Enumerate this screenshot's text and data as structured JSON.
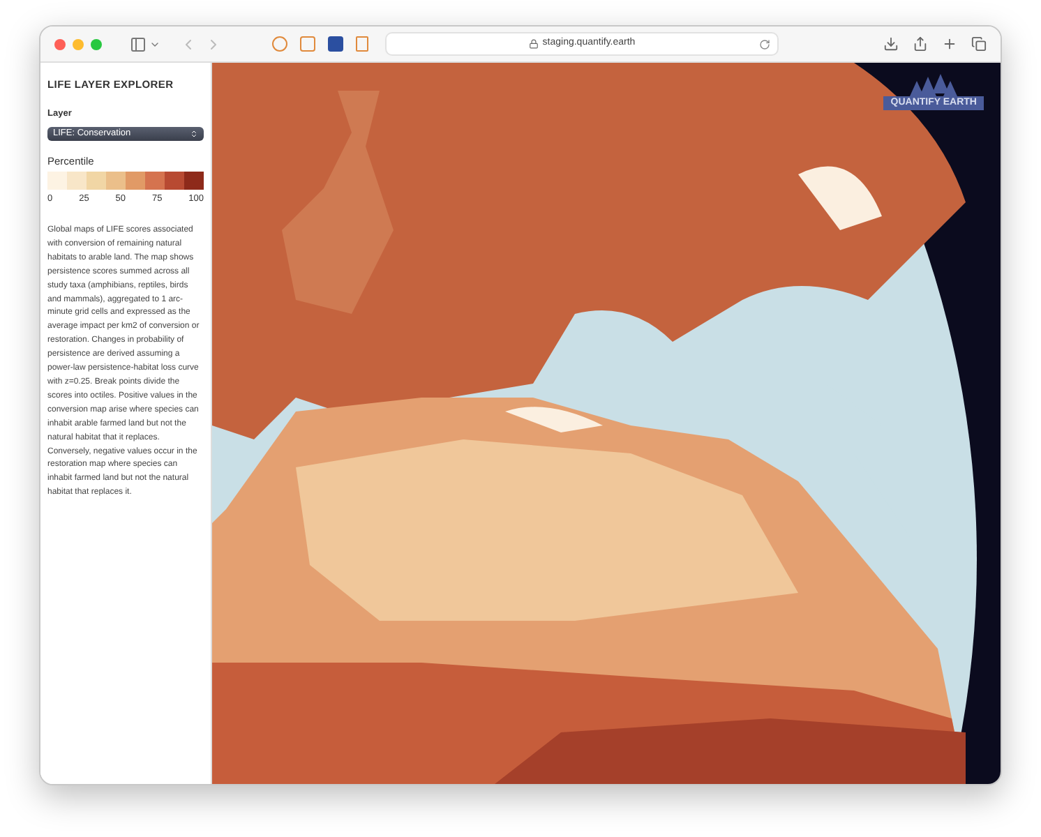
{
  "browser": {
    "url": "staging.quantify.earth"
  },
  "sidebar": {
    "title": "LIFE LAYER EXPLORER",
    "layer_label": "Layer",
    "layer_select": {
      "value": "LIFE: Conservation"
    },
    "legend": {
      "title": "Percentile",
      "swatches": [
        {
          "color": "#fdf3e3"
        },
        {
          "color": "#f8e6c8"
        },
        {
          "color": "#f1d6a5"
        },
        {
          "color": "#ebbf8a"
        },
        {
          "color": "#e19a66"
        },
        {
          "color": "#d5734f"
        },
        {
          "color": "#b84a32"
        },
        {
          "color": "#8e2a1a"
        }
      ],
      "ticks": [
        "0",
        "25",
        "50",
        "75",
        "100"
      ]
    },
    "description": "Global maps of LIFE scores associated with conversion of remaining natural habitats to arable land. The map shows persistence scores summed across all study taxa (amphibians, reptiles, birds and mammals), aggregated to 1 arc-minute grid cells and expressed as the average impact per km2 of conversion or restoration. Changes in probability of persistence are derived assuming a power-law persistence-habitat loss curve with z=0.25. Break points divide the scores into octiles. Positive values in the conversion map arise where species can inhabit arable farmed land but not the natural habitat that it replaces. Conversely, negative values occur in the restoration map where species can inhabit farmed land but not the natural habitat that replaces it."
  },
  "map": {
    "logo_text": "QUANTIFY EARTH"
  }
}
